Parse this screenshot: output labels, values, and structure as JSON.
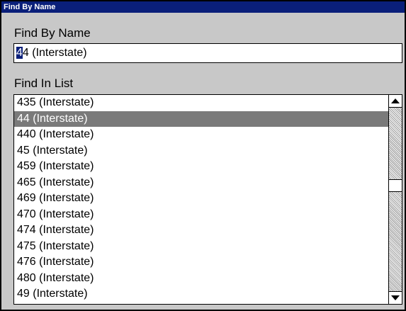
{
  "window": {
    "title": "Find By Name"
  },
  "find_by_name": {
    "label": "Find By Name",
    "value_cursor_char": "4",
    "value_rest": "4 (Interstate)"
  },
  "find_in_list": {
    "label": "Find In List",
    "selected_index": 1,
    "items": [
      "435 (Interstate)",
      "44 (Interstate)",
      "440 (Interstate)",
      "45 (Interstate)",
      "459 (Interstate)",
      "465 (Interstate)",
      "469 (Interstate)",
      "470 (Interstate)",
      "474 (Interstate)",
      "475 (Interstate)",
      "476 (Interstate)",
      "480 (Interstate)",
      "49 (Interstate)"
    ],
    "scroll_position": 0.42
  },
  "colors": {
    "titlebar": "#0a1f7a",
    "selection": "#7a7a7a",
    "window_bg": "#c8c8c8"
  }
}
